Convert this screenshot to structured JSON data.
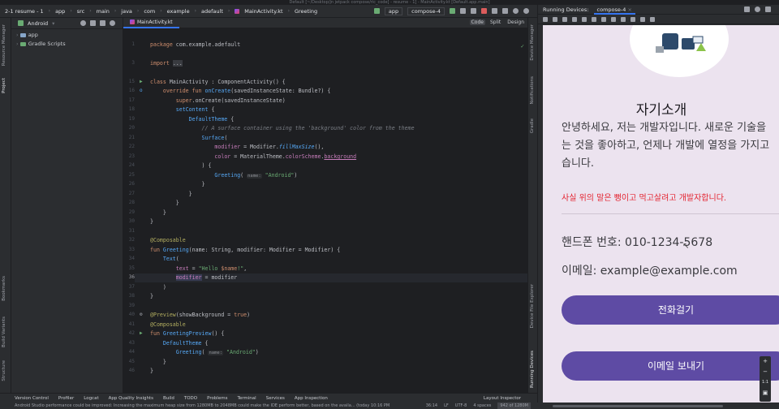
{
  "titlebar": {
    "text": "Default [~/Desktop/jn jetpack compose/ric_code] - resume - 1] - MainActivity.kt [Default.app.main]"
  },
  "nav": {
    "crumbs": [
      "2-1 resume - 1",
      "app",
      "src",
      "main",
      "java",
      "com",
      "example",
      "adefault",
      "MainActivity.kt",
      "Greeting"
    ],
    "run_config": "app",
    "device": "compose-4"
  },
  "leftstrip": {
    "resource_manager": "Resource Manager",
    "project": "Project",
    "bookmarks": "Bookmarks",
    "build_variants": "Build Variants",
    "structure": "Structure"
  },
  "project": {
    "view": "Android",
    "items": [
      {
        "label": "app"
      },
      {
        "label": "Gradle Scripts"
      }
    ]
  },
  "editor": {
    "tab": "MainActivity.kt",
    "view_modes": [
      "Code",
      "Split",
      "Design"
    ],
    "line_numbers": [
      "1",
      "3",
      "15",
      "16",
      "17",
      "18",
      "19",
      "20",
      "21",
      "22",
      "23",
      "24",
      "25",
      "26",
      "27",
      "28",
      "29",
      "30",
      "31",
      "32",
      "33",
      "34",
      "35",
      "36",
      "37",
      "38",
      "39",
      "40",
      "41",
      "42",
      "43",
      "44",
      "45",
      "46"
    ]
  },
  "rightstrip": {
    "device_manager": "Device Manager",
    "notifications": "Notifications",
    "gradle": "Gradle",
    "device_file_explorer": "Device File Explorer",
    "running_devices": "Running Devices"
  },
  "bottombar": {
    "items": [
      "Version Control",
      "Profiler",
      "Logcat",
      "App Quality Insights",
      "Build",
      "TODO",
      "Problems",
      "Terminal",
      "Services",
      "App Inspection",
      "Layout Inspector"
    ]
  },
  "status": {
    "message": "Android Studio performance could be improved: Increasing the maximum heap size from 1280MB to 2048MB could make the IDE perform better, based on the availa... (today 10:16 PM",
    "position": "36:14",
    "line_sep": "LF",
    "encoding": "UTF-8",
    "indent": "4 spaces",
    "memory": "942 of 1280M"
  },
  "devices": {
    "label": "Running Devices:",
    "tab": "compose-4"
  },
  "phone": {
    "title": "자기소개",
    "intro_lines": [
      "안녕하세요, 저는 개발자입니다. 새로운 기술을",
      "는 것을 좋아하고, 언제나 개발에 열정을 가지고",
      "습니다."
    ],
    "red_text": "사실 위의 말은 뻥이고 먹고살려고 개발자합니다.",
    "phone_label": "핸드폰 번호: 010-1234-5678",
    "email_label": "이메일: example@example.com",
    "call_button": "전화걸기",
    "email_button": "이메일 보내기"
  },
  "zoom": {
    "plus": "+",
    "minus": "−",
    "ratio": "1:1"
  }
}
